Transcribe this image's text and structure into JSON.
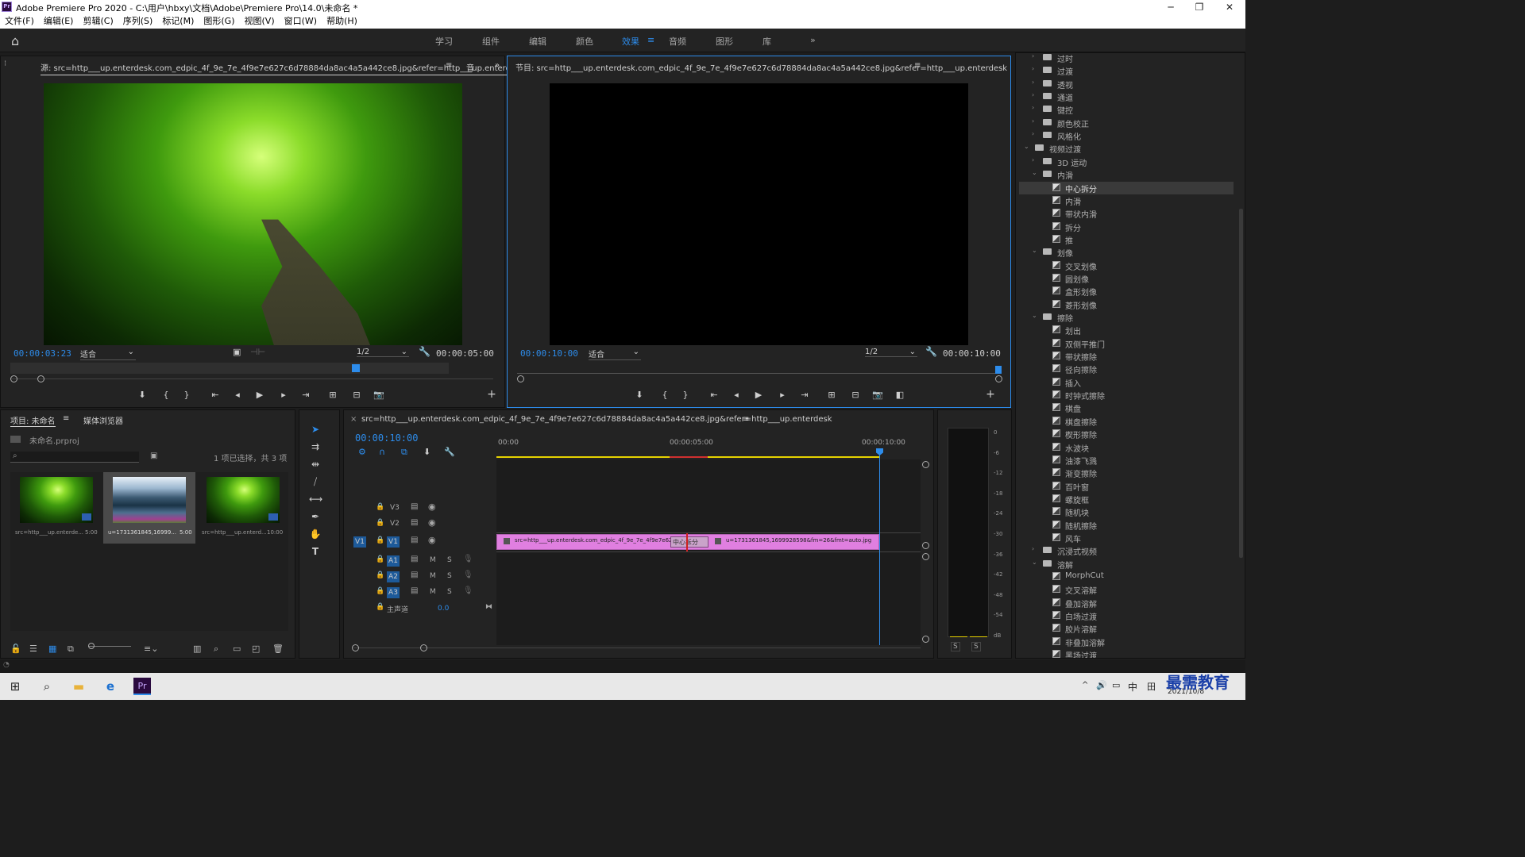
{
  "window": {
    "title": "Adobe Premiere Pro 2020 - C:\\用户\\hbxy\\文档\\Adobe\\Premiere Pro\\14.0\\未命名 *",
    "logo": "Pr"
  },
  "menu": [
    "文件(F)",
    "编辑(E)",
    "剪辑(C)",
    "序列(S)",
    "标记(M)",
    "图形(G)",
    "视图(V)",
    "窗口(W)",
    "帮助(H)"
  ],
  "workspaces": [
    "学习",
    "组件",
    "编辑",
    "颜色",
    "效果",
    "音频",
    "图形",
    "库"
  ],
  "active_workspace": "效果",
  "source_monitor": {
    "tab": "源: src=http___up.enterdesk.com_edpic_4f_9e_7e_4f9e7e627c6d78884da8ac4a5a442ce8.jpg&refer=http___up.enterdesk.jpg",
    "tab2": "音",
    "timecode": "00:00:03:23",
    "fit": "适合",
    "res": "1/2",
    "duration": "00:00:05:00"
  },
  "program_monitor": {
    "tab": "节目: src=http___up.enterdesk.com_edpic_4f_9e_7e_4f9e7e627c6d78884da8ac4a5a442ce8.jpg&refer=http___up.enterdesk",
    "timecode": "00:00:10:00",
    "fit": "适合",
    "res": "1/2",
    "duration": "00:00:10:00"
  },
  "project": {
    "tab": "项目: 未命名",
    "tab2": "媒体浏览器",
    "file": "未命名.prproj",
    "selection": "1 项已选择，共 3 项",
    "items": [
      {
        "name": "src=http___up.enterde...",
        "dur": "5:00"
      },
      {
        "name": "u=1731361845,16999...",
        "dur": "5:00"
      },
      {
        "name": "src=http___up.enterd...",
        "dur": "10:00"
      }
    ]
  },
  "timeline": {
    "tab": "src=http___up.enterdesk.com_edpic_4f_9e_7e_4f9e7e627c6d78884da8ac4a5a442ce8.jpg&refer=http___up.enterdesk",
    "timecode": "00:00:10:00",
    "ruler": [
      "00:00",
      "00:00:05:00",
      "00:00:10:00"
    ],
    "video_tracks": [
      "V3",
      "V2",
      "V1"
    ],
    "audio_tracks": [
      "A1",
      "A2",
      "A3"
    ],
    "master": "主声道",
    "master_val": "0.0",
    "clip1": "src=http___up.enterdesk.com_edpic_4f_9e_7e_4f9e7e62",
    "transition_label": "中心拆分",
    "clip2": "u=1731361845,1699928598&fm=26&fmt=auto.jpg",
    "track_btns": [
      "M",
      "S"
    ]
  },
  "meter": {
    "scale": [
      "0",
      "-6",
      "-12",
      "-18",
      "-24",
      "-30",
      "-36",
      "-42",
      "-48",
      "-54",
      "dB"
    ],
    "solo": [
      "S",
      "S"
    ]
  },
  "effects_tree": [
    {
      "level": 1,
      "type": "folder",
      "label": "过时",
      "open": false
    },
    {
      "level": 1,
      "type": "folder",
      "label": "过渡",
      "open": false
    },
    {
      "level": 1,
      "type": "folder",
      "label": "透视",
      "open": false
    },
    {
      "level": 1,
      "type": "folder",
      "label": "通道",
      "open": false
    },
    {
      "level": 1,
      "type": "folder",
      "label": "键控",
      "open": false
    },
    {
      "level": 1,
      "type": "folder",
      "label": "颜色校正",
      "open": false
    },
    {
      "level": 1,
      "type": "folder",
      "label": "风格化",
      "open": false
    },
    {
      "level": 0,
      "type": "folder",
      "label": "视频过渡",
      "open": true
    },
    {
      "level": 1,
      "type": "folder",
      "label": "3D 运动",
      "open": false
    },
    {
      "level": 1,
      "type": "folder",
      "label": "内滑",
      "open": true
    },
    {
      "level": 2,
      "type": "fx",
      "label": "中心拆分",
      "selected": true
    },
    {
      "level": 2,
      "type": "fx",
      "label": "内滑"
    },
    {
      "level": 2,
      "type": "fx",
      "label": "带状内滑"
    },
    {
      "level": 2,
      "type": "fx",
      "label": "拆分"
    },
    {
      "level": 2,
      "type": "fx",
      "label": "推"
    },
    {
      "level": 1,
      "type": "folder",
      "label": "划像",
      "open": true
    },
    {
      "level": 2,
      "type": "fx",
      "label": "交叉划像"
    },
    {
      "level": 2,
      "type": "fx",
      "label": "圆划像"
    },
    {
      "level": 2,
      "type": "fx",
      "label": "盒形划像"
    },
    {
      "level": 2,
      "type": "fx",
      "label": "菱形划像"
    },
    {
      "level": 1,
      "type": "folder",
      "label": "擦除",
      "open": true
    },
    {
      "level": 2,
      "type": "fx",
      "label": "划出"
    },
    {
      "level": 2,
      "type": "fx",
      "label": "双侧平推门"
    },
    {
      "level": 2,
      "type": "fx",
      "label": "带状擦除"
    },
    {
      "level": 2,
      "type": "fx",
      "label": "径向擦除"
    },
    {
      "level": 2,
      "type": "fx",
      "label": "插入"
    },
    {
      "level": 2,
      "type": "fx",
      "label": "时钟式擦除"
    },
    {
      "level": 2,
      "type": "fx",
      "label": "棋盘"
    },
    {
      "level": 2,
      "type": "fx",
      "label": "棋盘擦除"
    },
    {
      "level": 2,
      "type": "fx",
      "label": "楔形擦除"
    },
    {
      "level": 2,
      "type": "fx",
      "label": "水波块"
    },
    {
      "level": 2,
      "type": "fx",
      "label": "油漆飞溅"
    },
    {
      "level": 2,
      "type": "fx",
      "label": "渐变擦除"
    },
    {
      "level": 2,
      "type": "fx",
      "label": "百叶窗"
    },
    {
      "level": 2,
      "type": "fx",
      "label": "螺旋框"
    },
    {
      "level": 2,
      "type": "fx",
      "label": "随机块"
    },
    {
      "level": 2,
      "type": "fx",
      "label": "随机擦除"
    },
    {
      "level": 2,
      "type": "fx",
      "label": "风车"
    },
    {
      "level": 1,
      "type": "folder",
      "label": "沉浸式视频",
      "open": false
    },
    {
      "level": 1,
      "type": "folder",
      "label": "溶解",
      "open": true
    },
    {
      "level": 2,
      "type": "fx",
      "label": "MorphCut"
    },
    {
      "level": 2,
      "type": "fx",
      "label": "交叉溶解"
    },
    {
      "level": 2,
      "type": "fx",
      "label": "叠加溶解"
    },
    {
      "level": 2,
      "type": "fx",
      "label": "白场过渡"
    },
    {
      "level": 2,
      "type": "fx",
      "label": "胶片溶解"
    },
    {
      "level": 2,
      "type": "fx",
      "label": "非叠加溶解"
    },
    {
      "level": 2,
      "type": "fx",
      "label": "黑场过渡"
    }
  ],
  "taskbar": {
    "ime": "中",
    "date": "2021/10/8",
    "watermark": "最需教育"
  },
  "colors": {
    "accent": "#2d8ceb",
    "clip": "#e07fe0",
    "panel": "#232323"
  }
}
